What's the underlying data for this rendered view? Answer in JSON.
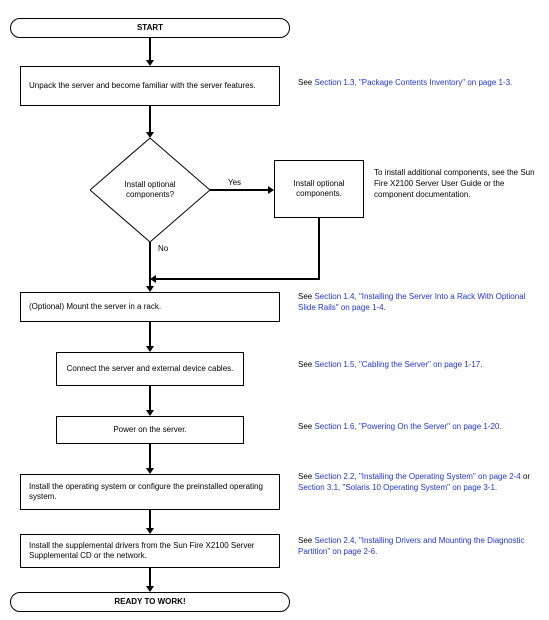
{
  "terminator_start": "START",
  "terminator_end": "READY TO WORK!",
  "step_unpack": "Unpack the server and become familiar with the server features.",
  "decision_optional": "Install optional components?",
  "opt_yes": "Yes",
  "opt_no": "No",
  "step_install_opt": "Install optional components.",
  "step_mount": "(Optional) Mount the server in a rack.",
  "step_cables": "Connect the server and external device cables.",
  "step_power": "Power on the server.",
  "step_os": "Install the operating system or configure the preinstalled operating system.",
  "step_drivers": "Install the supplemental drivers from the Sun Fire X2100 Server Supplemental CD or the network.",
  "note_unpack_pre": "See ",
  "note_unpack_link": "Section 1.3, \"Package Contents Inventory\" on page 1-3.",
  "note_install_opt": "To install additional components, see the Sun Fire X2100 Server User Guide or the component documentation.",
  "note_mount_pre": "See ",
  "note_mount_link": "Section 1.4, \"Installing the Server Into a Rack With Optional Slide Rails\" on page 1-4.",
  "note_cables_pre": "See ",
  "note_cables_link": "Section 1.5, \"Cabling the Server\" on page 1-17.",
  "note_power_pre": "See ",
  "note_power_link": "Section 1.6, \"Powering On the Server\" on page 1-20.",
  "note_os_pre": "See ",
  "note_os_link1": "Section 2.2, \"Installing the Operating System\" on page 2-4",
  "note_os_mid": " or ",
  "note_os_link2": "Section 3.1, \"Solaris 10 Operating System\" on page 3-1.",
  "note_drivers_pre": "See ",
  "note_drivers_link": "Section 2.4, \"Installing Drivers and Mounting the Diagnostic Partition\" on page 2-6.",
  "chart_data": {
    "type": "flowchart",
    "nodes": [
      {
        "id": "start",
        "type": "terminator",
        "label": "START"
      },
      {
        "id": "unpack",
        "type": "process",
        "label": "Unpack the server and become familiar with the server features."
      },
      {
        "id": "decide",
        "type": "decision",
        "label": "Install optional components?"
      },
      {
        "id": "installopt",
        "type": "process",
        "label": "Install optional components."
      },
      {
        "id": "mount",
        "type": "process",
        "label": "(Optional) Mount the server in a rack."
      },
      {
        "id": "cables",
        "type": "process",
        "label": "Connect the server and external device cables."
      },
      {
        "id": "power",
        "type": "process",
        "label": "Power on the server."
      },
      {
        "id": "os",
        "type": "process",
        "label": "Install the operating system or configure the preinstalled operating system."
      },
      {
        "id": "drivers",
        "type": "process",
        "label": "Install the supplemental drivers from the Sun Fire X2100 Server Supplemental CD or the network."
      },
      {
        "id": "end",
        "type": "terminator",
        "label": "READY TO WORK!"
      }
    ],
    "edges": [
      {
        "from": "start",
        "to": "unpack"
      },
      {
        "from": "unpack",
        "to": "decide"
      },
      {
        "from": "decide",
        "to": "installopt",
        "label": "Yes"
      },
      {
        "from": "decide",
        "to": "mount",
        "label": "No"
      },
      {
        "from": "installopt",
        "to": "mount"
      },
      {
        "from": "mount",
        "to": "cables"
      },
      {
        "from": "cables",
        "to": "power"
      },
      {
        "from": "power",
        "to": "os"
      },
      {
        "from": "os",
        "to": "drivers"
      },
      {
        "from": "drivers",
        "to": "end"
      }
    ],
    "annotations": [
      {
        "node": "unpack",
        "text": "See Section 1.3, \"Package Contents Inventory\" on page 1-3."
      },
      {
        "node": "installopt",
        "text": "To install additional components, see the Sun Fire X2100 Server User Guide or the component documentation."
      },
      {
        "node": "mount",
        "text": "See Section 1.4, \"Installing the Server Into a Rack With Optional Slide Rails\" on page 1-4."
      },
      {
        "node": "cables",
        "text": "See Section 1.5, \"Cabling the Server\" on page 1-17."
      },
      {
        "node": "power",
        "text": "See Section 1.6, \"Powering On the Server\" on page 1-20."
      },
      {
        "node": "os",
        "text": "See Section 2.2, \"Installing the Operating System\" on page 2-4 or Section 3.1, \"Solaris 10 Operating System\" on page 3-1."
      },
      {
        "node": "drivers",
        "text": "See Section 2.4, \"Installing Drivers and Mounting the Diagnostic Partition\" on page 2-6."
      }
    ]
  }
}
